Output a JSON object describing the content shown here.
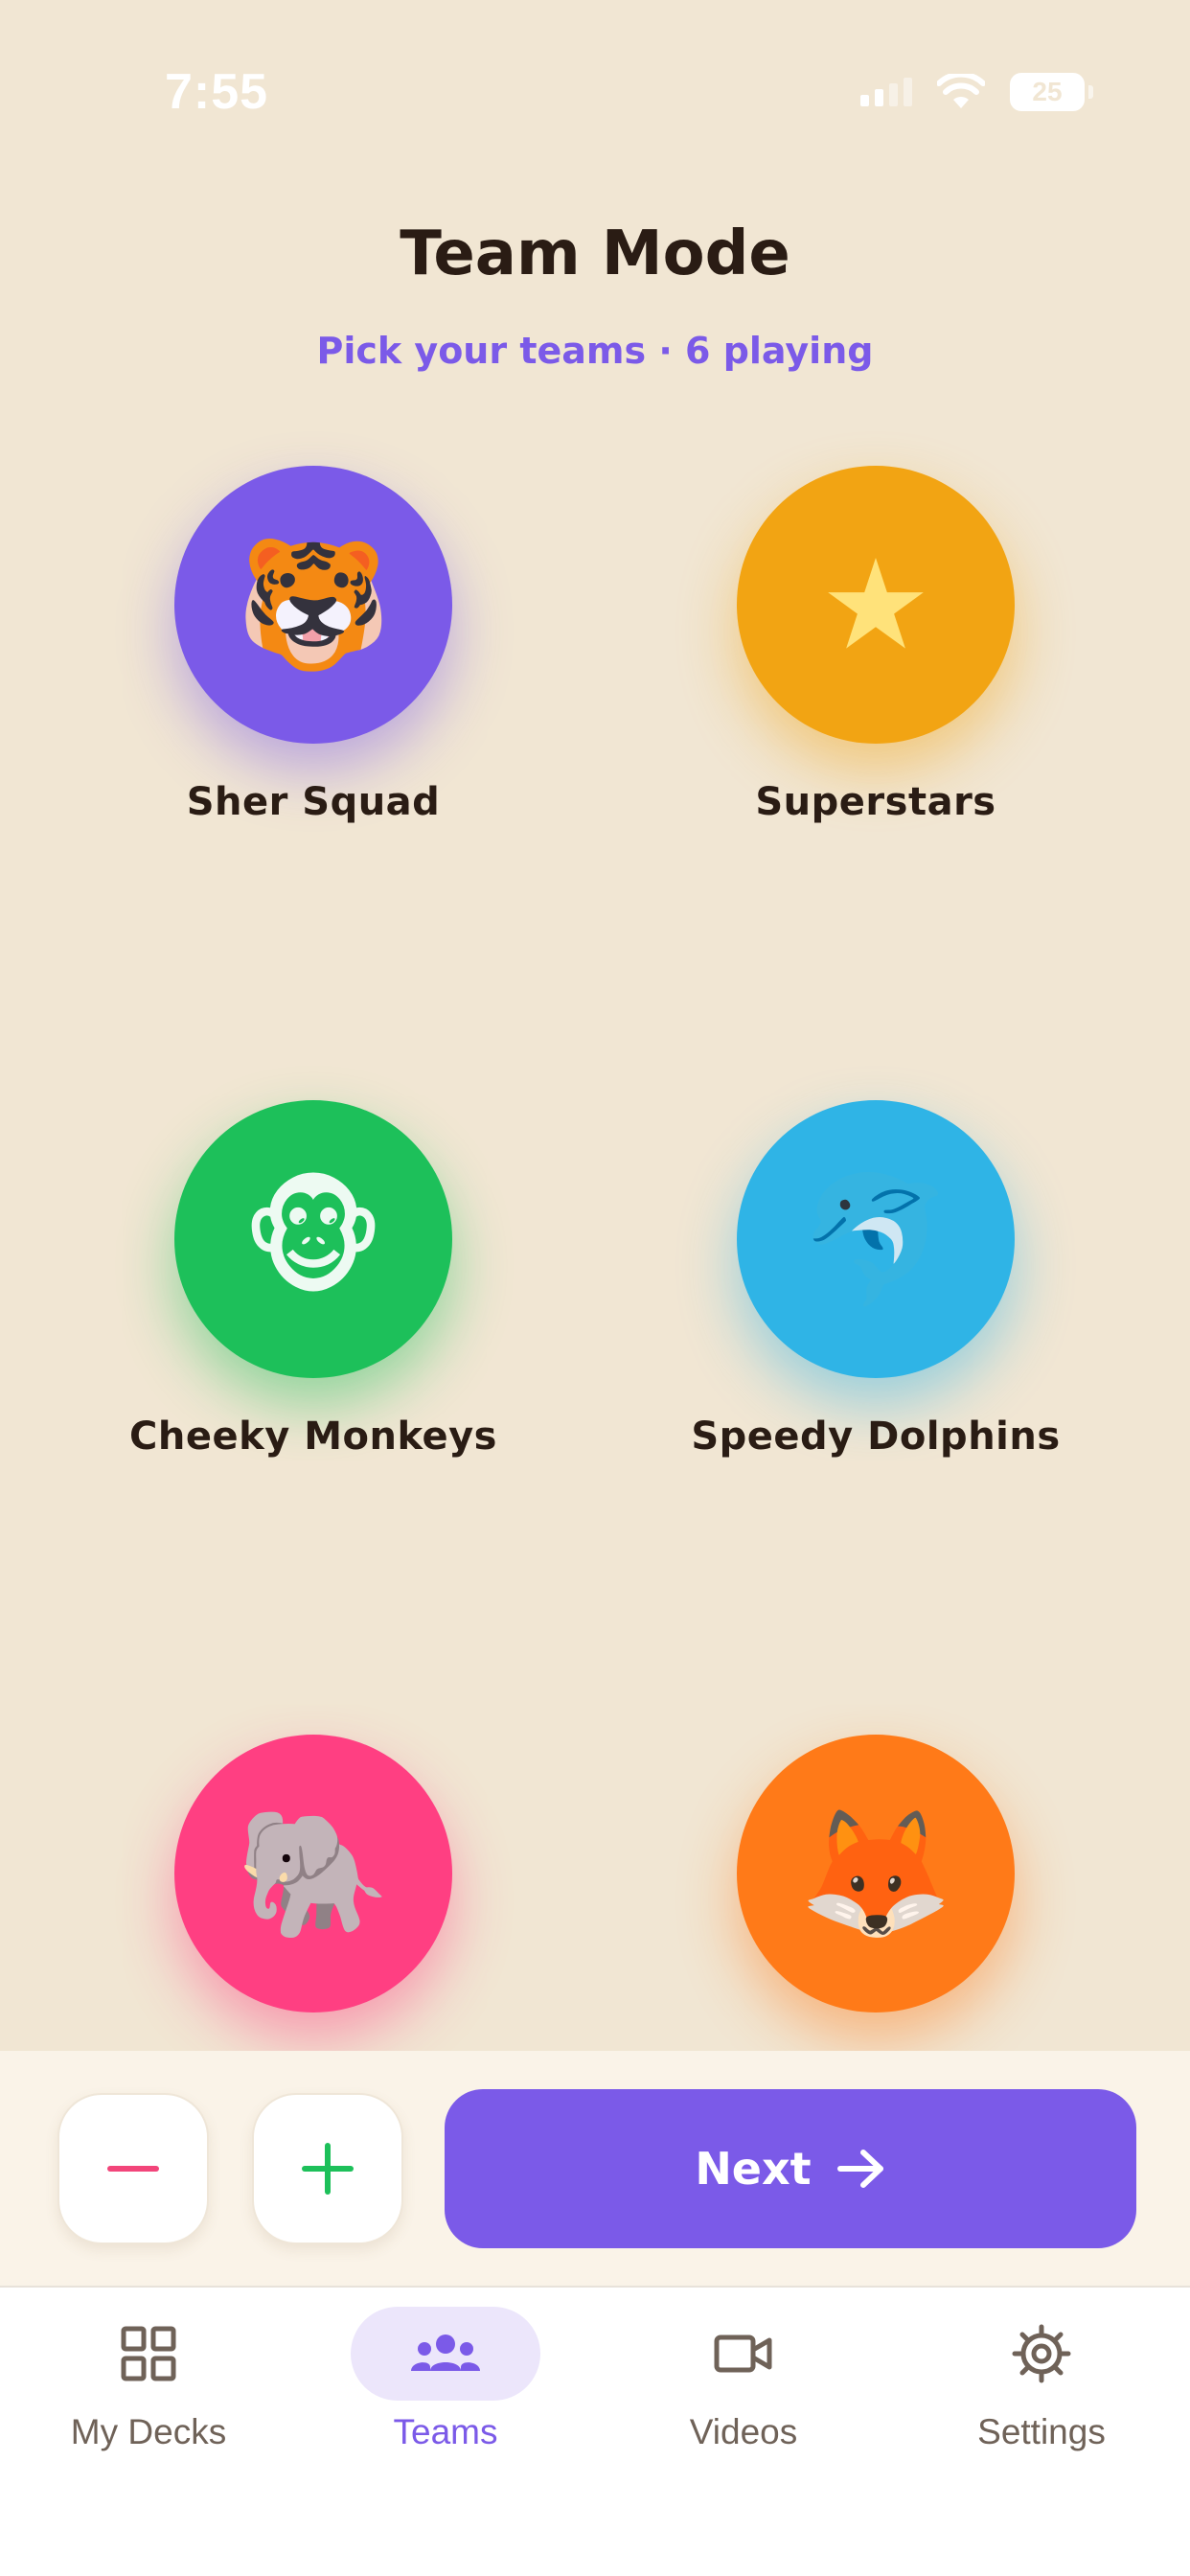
{
  "status_bar": {
    "time": "7:55",
    "battery": "25"
  },
  "header": {
    "title": "Team Mode",
    "subtitle": "Pick your teams · 6 playing"
  },
  "teams": [
    {
      "name": "Sher Squad",
      "icon": "tiger-icon",
      "glyph": "🐯",
      "color": "#7B5AE8"
    },
    {
      "name": "Superstars",
      "icon": "star-icon",
      "glyph": "★",
      "color": "#F2A413"
    },
    {
      "name": "Cheeky Monkeys",
      "icon": "monkey-icon",
      "glyph": "🐵",
      "color": "#1DC05A"
    },
    {
      "name": "Speedy Dolphins",
      "icon": "dolphin-icon",
      "glyph": "🐬",
      "color": "#2FB4E6"
    },
    {
      "name": "",
      "icon": "elephant-icon",
      "glyph": "🐘",
      "color": "#FF3F82"
    },
    {
      "name": "",
      "icon": "fox-icon",
      "glyph": "🦊",
      "color": "#FF7A18"
    }
  ],
  "actions": {
    "remove_icon": "minus-icon",
    "add_icon": "plus-icon",
    "next_label": "Next"
  },
  "tabs": [
    {
      "label": "My Decks",
      "icon": "grid-icon",
      "active": false
    },
    {
      "label": "Teams",
      "icon": "people-icon",
      "active": true
    },
    {
      "label": "Videos",
      "icon": "video-camera-icon",
      "active": false
    },
    {
      "label": "Settings",
      "icon": "gear-icon",
      "active": false
    }
  ],
  "colors": {
    "background": "#F1E6D3",
    "accent": "#7B5AE8",
    "minus": "#F2457A",
    "plus": "#1DC05A"
  }
}
